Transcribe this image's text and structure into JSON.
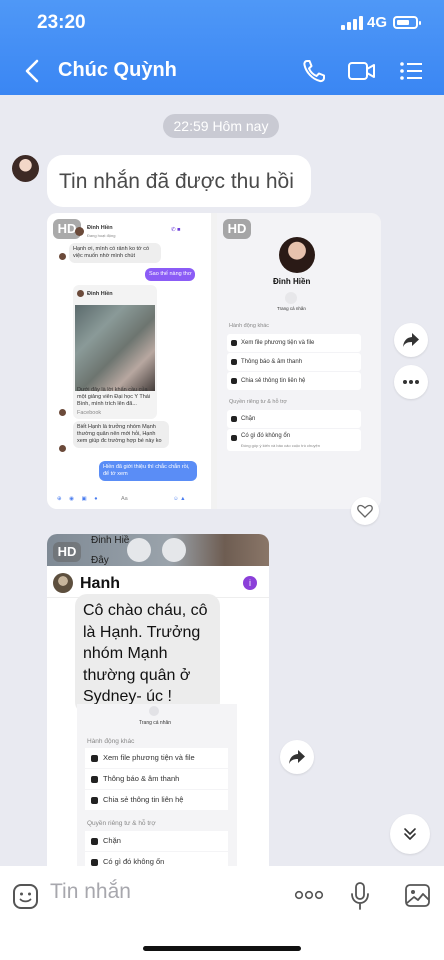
{
  "status_bar": {
    "time": "23:20",
    "network": "4G"
  },
  "header": {
    "contact_name": "Chúc Quỳnh",
    "back_icon": "chevron-left-icon",
    "call_icon": "phone-icon",
    "video_icon": "video-camera-icon",
    "menu_icon": "list-menu-icon"
  },
  "chat": {
    "date_chip": "22:59 Hôm nay",
    "recalled_message": "Tin nhắn đã được thu hồi"
  },
  "image1": {
    "hd_label": "HD",
    "left": {
      "name": "Đinh Hiền",
      "status": "Đang hoạt động",
      "msg1": "Hạnh ơi, mình có rảnh ko tớ có việc muốn nhờ mình chút",
      "reply1": "Sao thế nàng thơ",
      "card_name": "Đinh Hiền",
      "caption": "Dưới đây là lời khẩn cầu của một giảng viên Đại học Y Thái Bình, mình trích lên đã...",
      "source": "Facebook",
      "msg2": "Biết Hạnh là trưởng nhóm Mạnh thường quân nên mới hỏi, Hạnh xem giúp đc trường hợp bé này ko",
      "reply2": "Hiền đã giới thiệu thì chắc chắn rồi, để tớ xem",
      "composer": "Aa"
    },
    "right": {
      "name": "Đinh Hiền",
      "profile_label": "Trang cá nhân",
      "section1": "Hành động khác",
      "rows": [
        "Xem file phương tiện và file",
        "Thông báo & âm thanh",
        "Chia sẻ thông tin liên hệ"
      ],
      "section2": "Quyền riêng tư & hỗ trợ",
      "block": "Chặn",
      "report": "Có gì đó không ổn",
      "report_sub": "Đóng góp ý kiến và báo cáo cuộc trò chuyện"
    }
  },
  "image2": {
    "hd_label": "HD",
    "name": "Hanh",
    "message": "Cô chào cháu, cô là Hạnh. Trưởng nhóm Mạnh thường quân ở Sydney- úc !",
    "top_text1": "Đinh Hiề",
    "top_text2": "Đây",
    "profile_label": "Trang cá nhân",
    "section1": "Hành động khác",
    "rows": [
      "Xem file phương tiện và file",
      "Thông báo & âm thanh",
      "Chia sẻ thông tin liên hệ"
    ],
    "section2": "Quyền riêng tư & hỗ trợ",
    "block": "Chặn",
    "report": "Có gì đó không ổn"
  },
  "composer": {
    "placeholder": "Tin nhắn"
  }
}
